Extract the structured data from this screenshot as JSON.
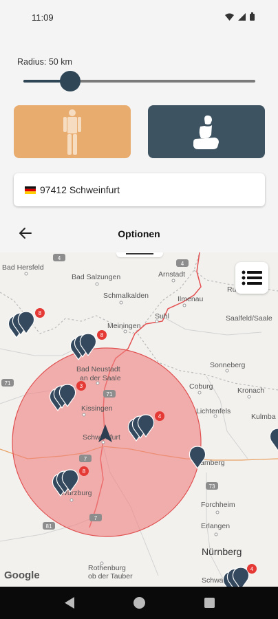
{
  "status_bar": {
    "time": "11:09"
  },
  "radius": {
    "label": "Radius: 50 km",
    "value_km": 50,
    "slider_fraction": 0.2
  },
  "modes": {
    "person_icon": "person-icon",
    "seat_icon": "car-seat-icon",
    "person_color": "#e8ac6e",
    "seat_color": "#3d5362"
  },
  "location": {
    "postal_city": "97412 Schweinfurt",
    "flag": "germany-flag-icon"
  },
  "header": {
    "title": "Optionen",
    "back_icon": "arrow-left-icon"
  },
  "map": {
    "circle_color": "#f08080",
    "attribution": "Google",
    "labels": {
      "bad_hersfeld": "Bad Hersfeld",
      "bad_salzungen": "Bad Salzungen",
      "arnstadt": "Arnstadt",
      "schmalkalden": "Schmalkalden",
      "ilmenau": "Ilmenau",
      "ru": "Ru",
      "suhl": "Suhl",
      "saalfeld": "Saalfeld/Saale",
      "meiningen": "Meiningen",
      "sonneberg": "Sonneberg",
      "bad_neustadt_1": "Bad Neustadt",
      "bad_neustadt_2": "an der Saale",
      "coburg": "Coburg",
      "kronach": "Kronach",
      "lichtenfels": "Lichtenfels",
      "kulmba": "Kulmba",
      "kissingen": "Kissingen",
      "schweinfurt": "Schweinfurt",
      "bamberg": "Bamberg",
      "wurzburg": "Würzburg",
      "forchheim": "Forchheim",
      "erlangen": "Erlangen",
      "nurnberg": "Nürnberg",
      "rothenburg_1": "Rothenburg",
      "rothenburg_2": "ob der Tauber",
      "schwab": "Schwab"
    },
    "road_numbers": {
      "r4a": "4",
      "r4b": "4",
      "r71a": "71",
      "r71b": "71",
      "r7a": "7",
      "r7b": "7",
      "r73": "73",
      "r81": "81"
    },
    "markers": [
      {
        "count": "8"
      },
      {
        "count": "8"
      },
      {
        "count": "3"
      },
      {
        "count": "4"
      },
      {
        "count": ""
      },
      {
        "count": "8"
      },
      {
        "count": "4"
      },
      {
        "count": ""
      }
    ]
  }
}
